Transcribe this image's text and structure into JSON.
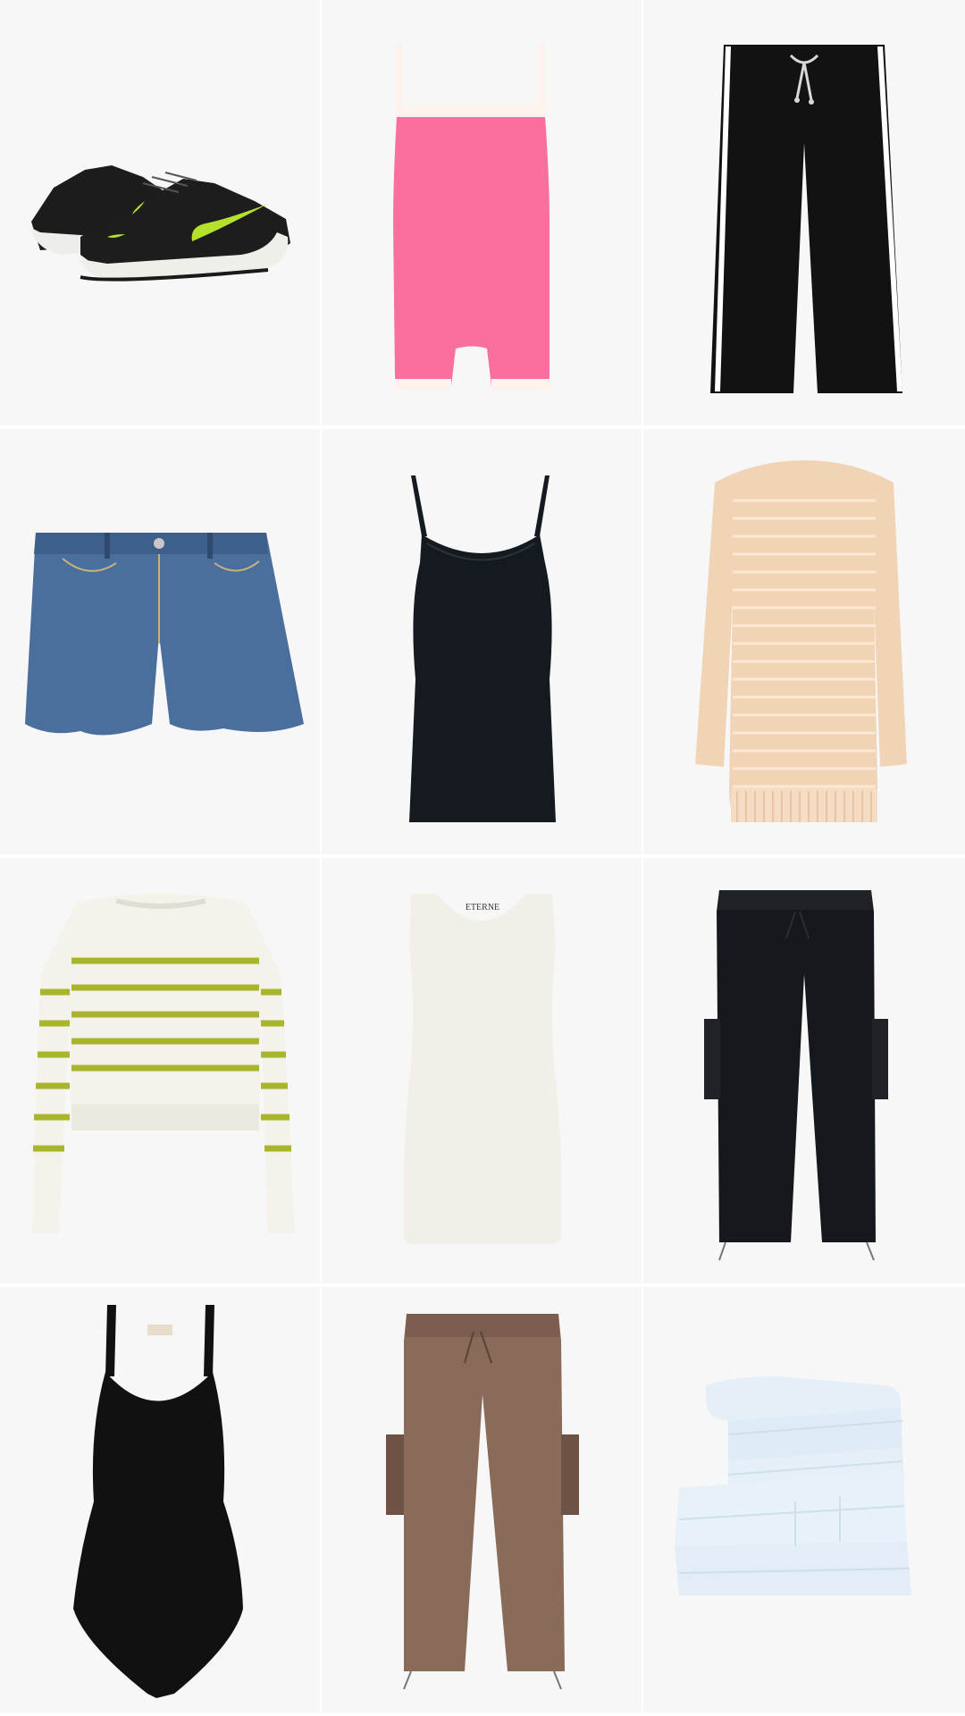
{
  "products": [
    {
      "name": "black-green-sneakers",
      "icon": "sneaker-icon",
      "color": "#1b1b1b",
      "accent": "#b5e02c"
    },
    {
      "name": "pink-romper",
      "icon": "romper-icon",
      "color": "#fb6f9f",
      "accent": "#fdf2ec"
    },
    {
      "name": "black-stripe-track-pants",
      "icon": "track-pants-icon",
      "color": "#111111",
      "accent": "#ffffff"
    },
    {
      "name": "denim-shorts",
      "icon": "shorts-icon",
      "color": "#4a6f9d",
      "accent": "#c9b27a"
    },
    {
      "name": "black-racerback-tank",
      "icon": "tank-top-icon",
      "color": "#141a20",
      "accent": "#141a20"
    },
    {
      "name": "cream-knit-dress",
      "icon": "dress-icon",
      "color": "#f1d4b5",
      "accent": "#fbe9d6"
    },
    {
      "name": "striped-knit-sweater",
      "icon": "sweater-icon",
      "color": "#f4f2ea",
      "accent": "#aab52e"
    },
    {
      "name": "white-tank-top",
      "icon": "tank-top-icon",
      "color": "#f1efe8",
      "accent": "#3a3a3a",
      "brand": "ETERNE"
    },
    {
      "name": "black-cargo-joggers",
      "icon": "cargo-pants-icon",
      "color": "#15181c",
      "accent": "#2a2e34"
    },
    {
      "name": "black-bodysuit",
      "icon": "bodysuit-icon",
      "color": "#111111",
      "accent": "#e9dccb"
    },
    {
      "name": "brown-cargo-joggers",
      "icon": "cargo-pants-icon",
      "color": "#8a6a58",
      "accent": "#6e5344"
    },
    {
      "name": "light-blue-towels",
      "icon": "towel-stack-icon",
      "color": "#e4eff8",
      "accent": "#cfdeeb"
    }
  ]
}
